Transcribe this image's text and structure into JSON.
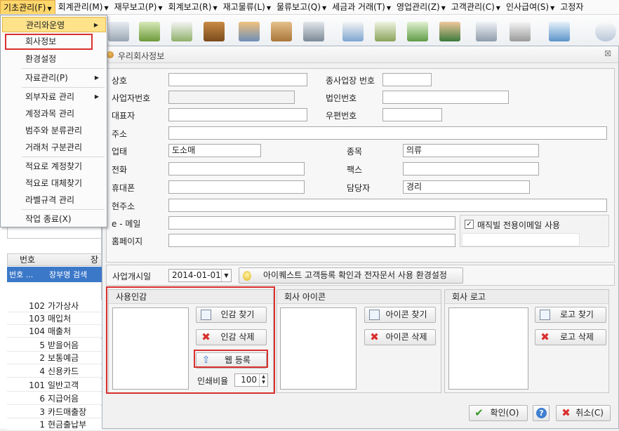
{
  "menubar": {
    "items": [
      {
        "label": "기초관리(F)"
      },
      {
        "label": "회계관리(M)"
      },
      {
        "label": "재무보고(P)"
      },
      {
        "label": "회계보고(R)"
      },
      {
        "label": "재고물류(L)"
      },
      {
        "label": "물류보고(Q)"
      },
      {
        "label": "세금과 거래(T)"
      },
      {
        "label": "영업관리(Z)"
      },
      {
        "label": "고객관리(C)"
      },
      {
        "label": "인사급여(S)"
      },
      {
        "label": "고정자"
      }
    ]
  },
  "dropdown": {
    "items": [
      {
        "label": "관리와운영"
      },
      {
        "label": "회사정보"
      },
      {
        "label": "환경설정"
      },
      {
        "label": "자료관리(P)"
      },
      {
        "label": "외부자료 관리"
      },
      {
        "label": "계정과목 관리"
      },
      {
        "label": "범주와 분류관리"
      },
      {
        "label": "거래처 구분관리"
      },
      {
        "label": "적요로 계정찾기"
      },
      {
        "label": "적요로 대체찾기"
      },
      {
        "label": "라벨규격 관리"
      },
      {
        "label": "작업 종료(X)"
      }
    ]
  },
  "left_grid": {
    "col_num": "번호",
    "col_name": "장",
    "filter_num": "번호 ...",
    "filter_name": "장부명 검색",
    "rows": [
      {
        "num": "102",
        "name": "가가상사"
      },
      {
        "num": "103",
        "name": "매입처"
      },
      {
        "num": "104",
        "name": "매출처"
      },
      {
        "num": "5",
        "name": "받을어음"
      },
      {
        "num": "2",
        "name": "보통예금"
      },
      {
        "num": "4",
        "name": "신용카드"
      },
      {
        "num": "101",
        "name": "일반고객"
      },
      {
        "num": "6",
        "name": "지급어음"
      },
      {
        "num": "3",
        "name": "카드매출장"
      },
      {
        "num": "1",
        "name": "현금출납부"
      }
    ]
  },
  "dialog": {
    "title": "우리회사정보",
    "close": "☒",
    "fields": {
      "company_name": {
        "label": "상호",
        "value": ""
      },
      "branch_no": {
        "label": "종사업장 번호",
        "value": ""
      },
      "biz_no": {
        "label": "사업자번호",
        "value": ""
      },
      "corp_no": {
        "label": "법인번호",
        "value": ""
      },
      "ceo": {
        "label": "대표자",
        "value": ""
      },
      "zip": {
        "label": "우편번호",
        "value": ""
      },
      "address": {
        "label": "주소",
        "value": ""
      },
      "biz_type": {
        "label": "업태",
        "value": "도소매"
      },
      "biz_item": {
        "label": "종목",
        "value": "의류"
      },
      "phone": {
        "label": "전화",
        "value": ""
      },
      "fax": {
        "label": "팩스",
        "value": ""
      },
      "mobile": {
        "label": "휴대폰",
        "value": ""
      },
      "manager": {
        "label": "담당자",
        "value": "경리"
      },
      "cur_address": {
        "label": "현주소",
        "value": ""
      },
      "email": {
        "label": "e - 메일",
        "value": ""
      },
      "homepage": {
        "label": "홈페이지",
        "value": ""
      },
      "bill_email_checkbox": {
        "label": "매직빌 전용이메일 사용",
        "checked": true
      }
    },
    "start_date": {
      "label": "사업개시일",
      "value": "2014-01-01"
    },
    "info_button": "아이퀘스트 고객등록 확인과 전자문서 사용 환경설정",
    "seal_group": {
      "title": "사용인감",
      "find": "인감 찾기",
      "delete": "인감 삭제",
      "web": "웹 등록",
      "ratio_label": "인쇄비율",
      "ratio_value": "100"
    },
    "icon_group": {
      "title": "회사 아이콘",
      "find": "아이콘 찾기",
      "delete": "아이콘 삭제"
    },
    "logo_group": {
      "title": "회사 로고",
      "find": "로고 찾기",
      "delete": "로고 삭제"
    },
    "ok_button": "확인(O)",
    "help_button": "?",
    "cancel_button": "취소(C)"
  }
}
